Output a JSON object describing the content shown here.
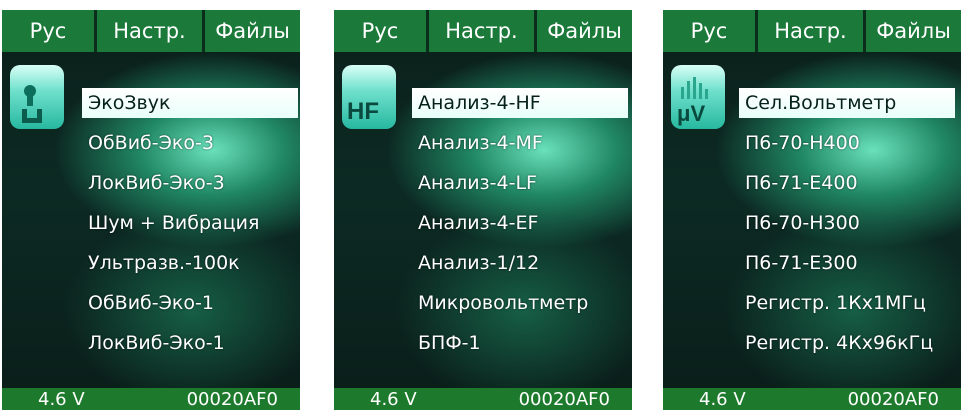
{
  "colors": {
    "tab_bg": "#1b7a3a",
    "footer_bg": "#1d7a2c",
    "selection_bg": "#ffffff",
    "text": "#ffffff"
  },
  "screens": [
    {
      "tabs": [
        "Рус",
        "Настр.",
        "Файлы"
      ],
      "icon": {
        "name": "echo-sound-icon",
        "text": ""
      },
      "items": [
        "ЭкоЗвук",
        "ОбВиб-Эко-3",
        "ЛокВиб-Эко-3",
        "Шум + Вибрация",
        "Ультразв.-100к",
        "ОбВиб-Эко-1",
        "ЛокВиб-Эко-1"
      ],
      "selected_index": 0,
      "footer": {
        "voltage": "4.6 V",
        "id": "00020AF0"
      }
    },
    {
      "tabs": [
        "Рус",
        "Настр.",
        "Файлы"
      ],
      "icon": {
        "name": "hf-icon",
        "text": "HF"
      },
      "items": [
        "Анализ-4-HF",
        "Анализ-4-MF",
        "Анализ-4-LF",
        "Анализ-4-EF",
        "Анализ-1/12",
        "Микровольтметр",
        "БПФ-1"
      ],
      "selected_index": 0,
      "footer": {
        "voltage": "4.6 V",
        "id": "00020AF0"
      }
    },
    {
      "tabs": [
        "Рус",
        "Настр.",
        "Файлы"
      ],
      "icon": {
        "name": "microvolt-icon",
        "text": "μV"
      },
      "items": [
        "Сел.Вольтметр",
        "П6-70-Н400",
        "П6-71-Е400",
        "П6-70-Н300",
        "П6-71-Е300",
        "Регистр. 1Кх1МГц",
        "Регистр. 4Кх96кГц"
      ],
      "selected_index": 0,
      "footer": {
        "voltage": "4.6 V",
        "id": "00020AF0"
      }
    }
  ]
}
